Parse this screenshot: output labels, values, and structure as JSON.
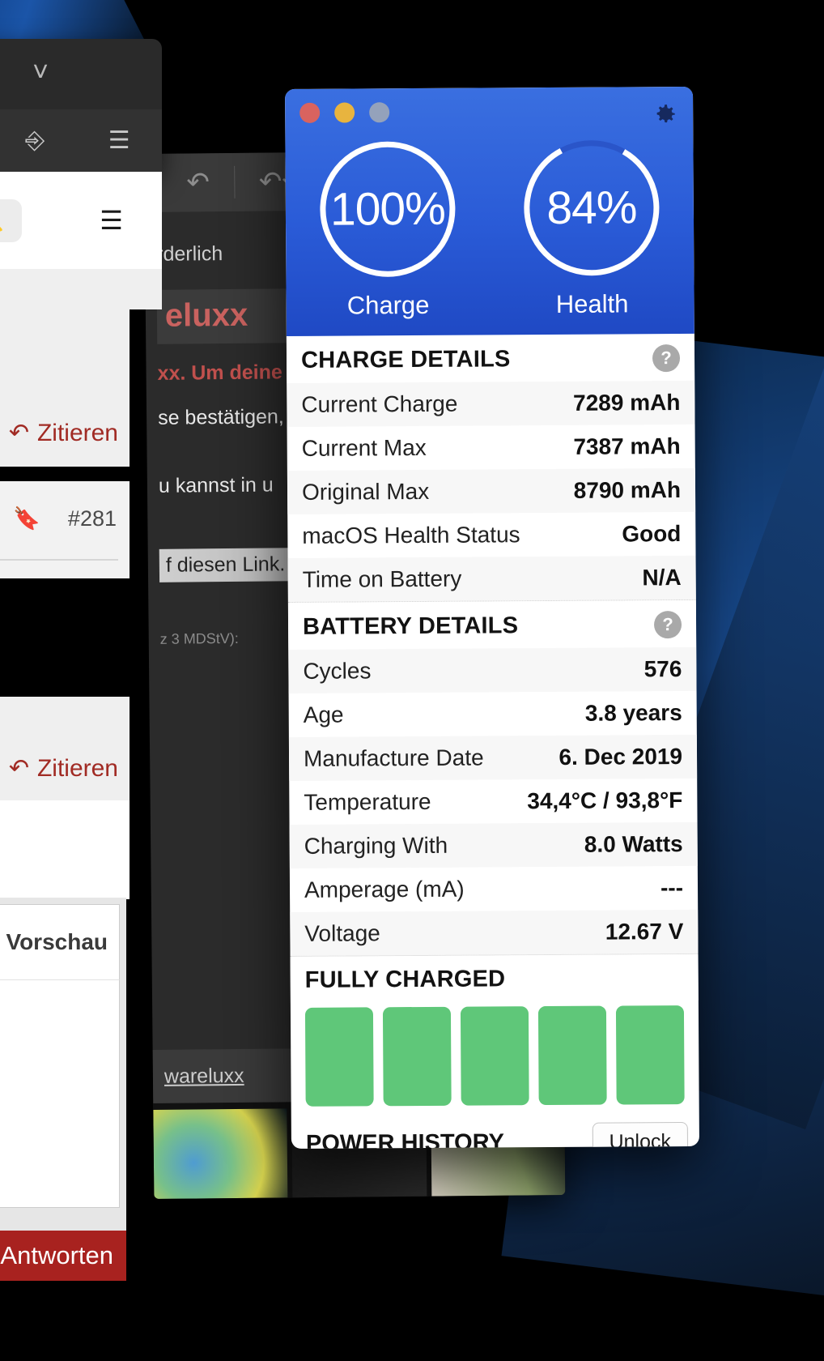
{
  "battery_app": {
    "window_controls": [
      "close",
      "minimize",
      "zoom"
    ],
    "settings_icon": "gear-icon",
    "gauges": [
      {
        "value": "100%",
        "label": "Charge",
        "percent": 100
      },
      {
        "value": "84%",
        "label": "Health",
        "percent": 84
      }
    ],
    "charge_details": {
      "title": "CHARGE DETAILS",
      "help": "?",
      "rows": [
        {
          "key": "Current Charge",
          "value": "7289 mAh"
        },
        {
          "key": "Current Max",
          "value": "7387 mAh"
        },
        {
          "key": "Original Max",
          "value": "8790 mAh"
        },
        {
          "key": "macOS Health Status",
          "value": "Good"
        },
        {
          "key": "Time on Battery",
          "value": "N/A"
        }
      ]
    },
    "battery_details": {
      "title": "BATTERY DETAILS",
      "help": "?",
      "rows": [
        {
          "key": "Cycles",
          "value": "576"
        },
        {
          "key": "Age",
          "value": "3.8 years"
        },
        {
          "key": "Manufacture Date",
          "value": "6. Dec 2019"
        },
        {
          "key": "Temperature",
          "value": "34,4°C / 93,8°F"
        },
        {
          "key": "Charging With",
          "value": "8.0 Watts"
        },
        {
          "key": "Amperage (mA)",
          "value": "---"
        },
        {
          "key": "Voltage",
          "value": "12.67 V"
        }
      ]
    },
    "fully_charged": {
      "title": "FULLY CHARGED",
      "bar_count": 5,
      "bar_color": "#5fc779"
    },
    "power_history": {
      "title": "POWER HISTORY",
      "unlock_label": "Unlock"
    }
  },
  "forum_window": {
    "toolbar_icons": [
      "undo-icon",
      "reply-all-icon"
    ],
    "lines": {
      "top": "rderlich",
      "brand": "eluxx",
      "body1": "xx. Um deine",
      "body2": "se bestätigen,",
      "body3": "u kannst in u",
      "link_line": "f diesen Link.",
      "legal": "z 3 MDStV):"
    },
    "footer_link": "wareluxx"
  },
  "left_panel": {
    "popup_chevron": "chevron-down-icon",
    "browser_icons": [
      "download-icon",
      "extensions-icon",
      "menu-icon"
    ],
    "site_icons": [
      "bell-icon",
      "menu-icon"
    ],
    "quote_label_1": "Zitieren",
    "quote_label_2": "Zitieren",
    "post_number": "#281",
    "bookmark_icon": "bookmark-icon",
    "share_icon": "share-icon",
    "preview_label": "Vorschau",
    "reply_button": "Antworten"
  },
  "colors": {
    "accent_blue": "#2a5bd7",
    "green": "#5fc779",
    "red_brand": "#a8221f",
    "quote_red": "#a12b24"
  }
}
